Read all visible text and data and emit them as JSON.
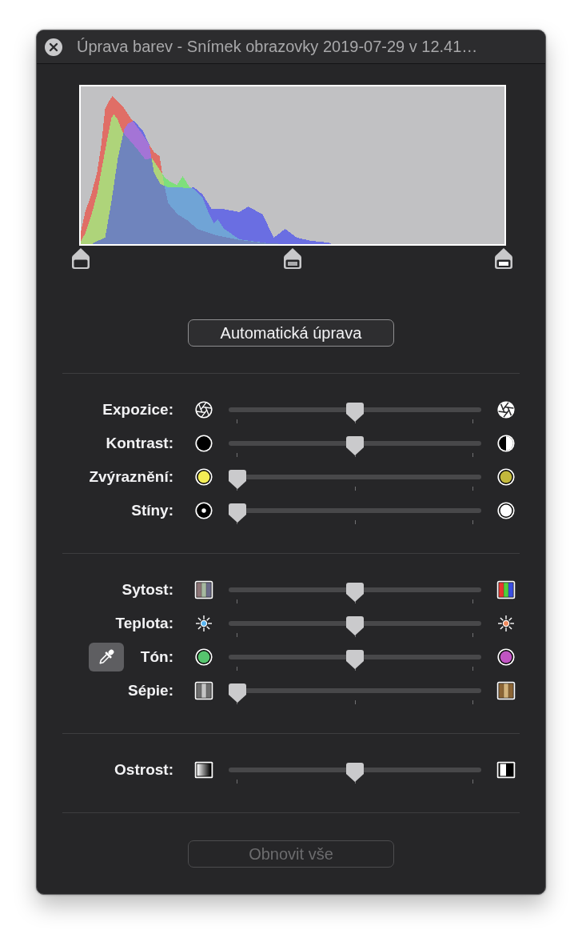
{
  "window": {
    "title": "Úprava barev - Snímek obrazovky 2019-07-29 v 12.41…"
  },
  "histogram": {
    "handles": [
      {
        "kind": "shadows",
        "level": 0
      },
      {
        "kind": "midtones",
        "level": 0.5
      },
      {
        "kind": "highlights",
        "level": 1
      }
    ]
  },
  "auto_button": {
    "label": "Automatická úprava",
    "disabled": false
  },
  "groups": [
    {
      "sliders": [
        {
          "kind": "exposure",
          "label": "Expozice:",
          "level": 0.5
        },
        {
          "kind": "contrast",
          "label": "Kontrast:",
          "level": 0.5
        },
        {
          "kind": "highlights",
          "label": "Zvýraznění:",
          "level": 0
        },
        {
          "kind": "shadows",
          "label": "Stíny:",
          "level": 0
        }
      ]
    },
    {
      "sliders": [
        {
          "kind": "saturation",
          "label": "Sytost:",
          "level": 0.5
        },
        {
          "kind": "temperature",
          "label": "Teplota:",
          "level": 0.5
        },
        {
          "kind": "tint",
          "label": "Tón:",
          "level": 0.5
        },
        {
          "kind": "sepia",
          "label": "Sépie:",
          "level": 0
        }
      ]
    },
    {
      "sliders": [
        {
          "kind": "sharpness",
          "label": "Ostrost:",
          "level": 0.5
        }
      ]
    }
  ],
  "reset_button": {
    "label": "Obnovit vše",
    "disabled": true
  }
}
